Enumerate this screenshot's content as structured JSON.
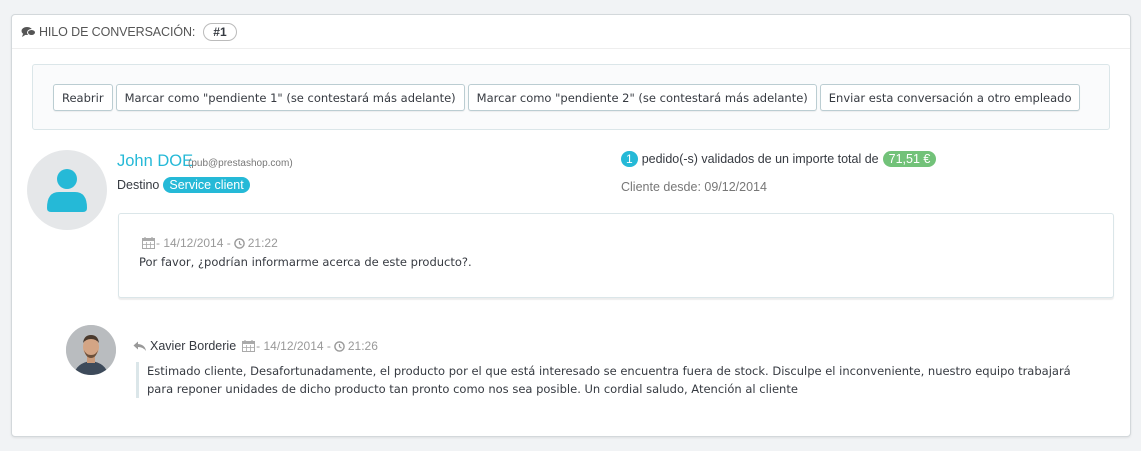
{
  "heading": {
    "icon": "comments-icon",
    "label": "HILO DE CONVERSACIÓN:",
    "thread_number": "#1"
  },
  "actions": {
    "reopen": "Reabrir",
    "pending1": "Marcar como \"pendiente 1\" (se contestará más adelante)",
    "pending2": "Marcar como \"pendiente 2\" (se contestará más adelante)",
    "forward": "Enviar esta conversación a otro empleado"
  },
  "customer": {
    "name": "John DOE",
    "email": "(pub@prestashop.com)",
    "destination_label": "Destino",
    "destination": "Service client",
    "orders_count": "1",
    "orders_text": "pedido(-s) validados de un importe total de",
    "orders_total": "71,51 €",
    "client_since": "Cliente desde: 09/12/2014"
  },
  "message": {
    "date": "- 14/12/2014 -",
    "time": "21:22",
    "text": "Por favor, ¿podrían informarme acerca de este producto?."
  },
  "reply": {
    "author": "Xavier Borderie",
    "date": "- 14/12/2014 -",
    "time": "21:26",
    "text": "Estimado cliente, Desafortunadamente, el producto por el que está interesado se encuentra fuera de stock. Disculpe el inconveniente, nuestro equipo trabajará para reponer unidades de dicho producto tan pronto como nos sea posible. Un cordial saludo, Atención al cliente"
  },
  "colors": {
    "accent": "#25b9d7",
    "success": "#72c279",
    "muted": "#999999"
  }
}
